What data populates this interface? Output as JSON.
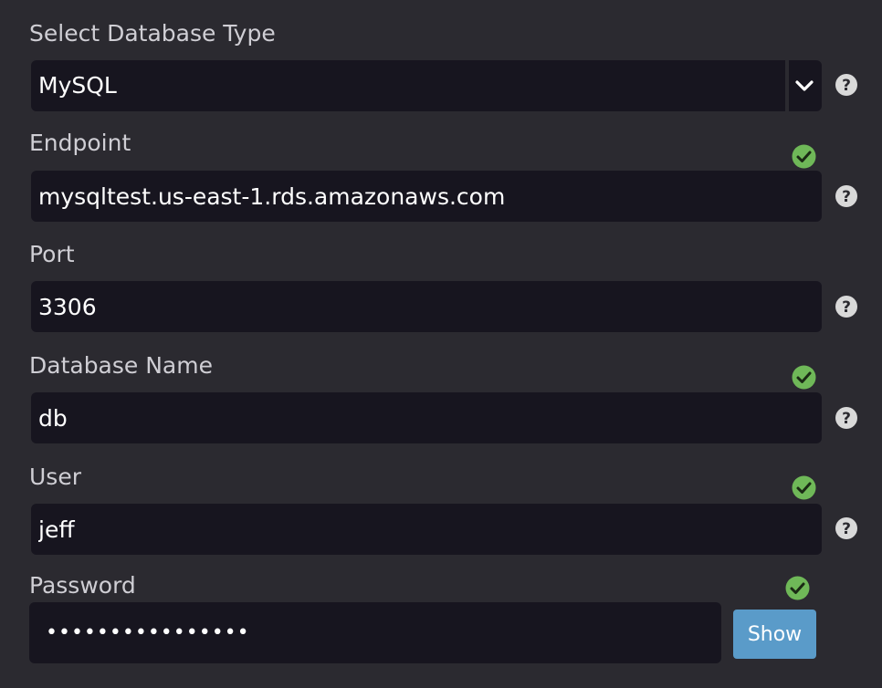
{
  "db_type": {
    "label": "Select Database Type",
    "selected": "MySQL"
  },
  "endpoint": {
    "label": "Endpoint",
    "value": "mysqltest.us-east-1.rds.amazonaws.com",
    "valid": true
  },
  "port": {
    "label": "Port",
    "value": "3306"
  },
  "database_name": {
    "label": "Database Name",
    "value": "db",
    "valid": true
  },
  "user": {
    "label": "User",
    "value": "jeff",
    "valid": true
  },
  "password": {
    "label": "Password",
    "value": "••••••••••••••••",
    "valid": true,
    "show_label": "Show"
  },
  "icons": {
    "help": "help-circle-icon",
    "valid": "check-circle-icon",
    "dropdown": "chevron-down-icon"
  },
  "colors": {
    "background": "#2b2a30",
    "field_background": "#17151f",
    "valid_green": "#6fb858",
    "button_blue": "#5a9bc9",
    "help_icon": "#d9d9d9"
  }
}
